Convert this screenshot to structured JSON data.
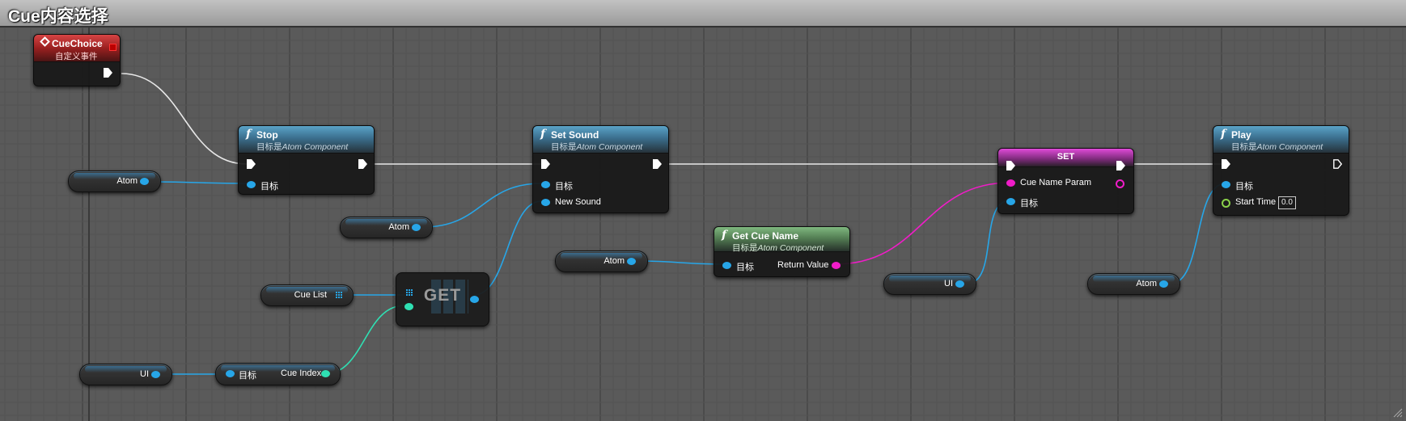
{
  "graph": {
    "title": "Cue内容选择"
  },
  "nodes": {
    "event": {
      "title": "CueChoice",
      "subtitle": "自定义事件"
    },
    "stop": {
      "title": "Stop",
      "subtitle_prefix": "目标是",
      "subtitle_target": "Atom Component",
      "pin_target": "目标"
    },
    "set_sound": {
      "title": "Set Sound",
      "subtitle_prefix": "目标是",
      "subtitle_target": "Atom Component",
      "pin_target": "目标",
      "pin_new_sound": "New Sound"
    },
    "get_cue_name": {
      "title": "Get Cue Name",
      "subtitle_prefix": "目标是",
      "subtitle_target": "Atom Component",
      "pin_target": "目标",
      "pin_return": "Return Value"
    },
    "set_var": {
      "title": "SET",
      "pin_cue_name_param": "Cue Name Param",
      "pin_target": "目标"
    },
    "play": {
      "title": "Play",
      "subtitle_prefix": "目标是",
      "subtitle_target": "Atom Component",
      "pin_target": "目标",
      "pin_start_time": "Start Time",
      "start_time_value": "0.0"
    },
    "get_array": {
      "title": "GET"
    },
    "cue_index": {
      "pin_target": "目标",
      "pin_cue_index": "Cue Index"
    }
  },
  "variables": {
    "atom_1": "Atom",
    "atom_2": "Atom",
    "atom_3": "Atom",
    "atom_4": "Atom",
    "cue_list": "Cue List",
    "ui_1": "UI",
    "ui_2": "UI"
  },
  "colors": {
    "object_pin": "#27a6e8",
    "integer_pin": "#2fe0b3",
    "name_pin": "#f01cc8",
    "float_pin": "#8bd24a",
    "exec_wire": "#e8e8e8",
    "function_header": "#3b6f8e",
    "pure_header": "#547f54",
    "event_header": "#9a2020"
  },
  "icons": {
    "function": "function-icon",
    "event": "event-diamond-icon",
    "exec": "exec-arrow-icon",
    "array": "array-grid-icon"
  }
}
